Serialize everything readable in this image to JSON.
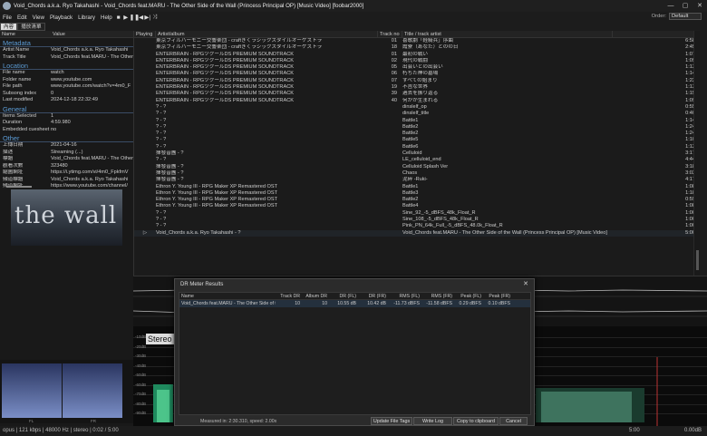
{
  "window": {
    "title": "Void_Chords a.k.a. Ryo Takahashi - Void_Chords feat.MARU - The Other Side of the Wall (Princess Principal OP) [Music Video]  [foobar2000]",
    "controls": [
      "—",
      "▢",
      "✕"
    ]
  },
  "menu": [
    "File",
    "Edit",
    "View",
    "Playback",
    "Library",
    "Help"
  ],
  "toolbar": [
    "■",
    "▶",
    "❚❚",
    "|◀",
    "▶|",
    "⤨"
  ],
  "order": {
    "label": "Order:",
    "value": "Default"
  },
  "tabs": [
    "內容",
    "播放清單"
  ],
  "properties": {
    "headers": [
      "Name",
      "Value"
    ],
    "sections": [
      {
        "title": "Metadata",
        "rows": [
          [
            "Artist Name",
            "Void_Chords a.k.a. Ryo Takahashi"
          ],
          [
            "Track Title",
            "Void_Chords feat.MARU - The Other"
          ]
        ]
      },
      {
        "title": "Location",
        "rows": [
          [
            "File name",
            "watch"
          ],
          [
            "Folder name",
            "www.youtube.com"
          ],
          [
            "File path",
            "www.youtube.com/watch?v=4m0_F"
          ],
          [
            "Subsong index",
            "0"
          ],
          [
            "Last modified",
            "2024-12-18 22:32:49"
          ]
        ]
      },
      {
        "title": "General",
        "rows": [
          [
            "Items Selected",
            "1"
          ],
          [
            "Duration",
            "4:59.980"
          ],
          [
            "Embedded cuesheet",
            "no"
          ]
        ]
      },
      {
        "title": "Other",
        "rows": [
          [
            "上傳日期",
            "2021-04-16"
          ],
          [
            "描述",
            "Streaming (...)"
          ],
          [
            "標題",
            "Void_Chords feat.MARU - The Other"
          ],
          [
            "觀看次數",
            "323480"
          ],
          [
            "縮圖網址",
            "https://i.ytimg.com/vi/4m0_FpkfmV"
          ],
          [
            "頻道標題",
            "Void_Chords a.k.a. Ryo Takahashi"
          ],
          [
            "頻道網址",
            "https://www.youtube.com/channel/"
          ]
        ]
      }
    ]
  },
  "album_art_text": "the wall",
  "vu": {
    "left_label": "FL",
    "right_label": "FR"
  },
  "playlist": {
    "headers": [
      "Playing",
      "Artist/album",
      "Track no",
      "Title / track artist",
      ""
    ],
    "rows": [
      [
        "",
        "東京フィルハーモニー交響楽団 - craftきくラシックスタイルオーケストラ",
        "01",
        "喜歌劇「軽騎兵」序曲",
        "6:58"
      ],
      [
        "",
        "東京フィルハーモニー交響楽団 - craftきくラシックスタイルオーケストラ",
        "18",
        "霞寮（あなた）とのの日",
        "2:45"
      ],
      [
        "",
        "ENTERBRAIN - RPGツクールDS PREMIUM SOUNDTRACK",
        "01",
        "最初の戦い",
        "1:07"
      ],
      [
        "",
        "ENTERBRAIN - RPGツクールDS PREMIUM SOUNDTRACK",
        "02",
        "現代の戦闘",
        "1:09"
      ],
      [
        "",
        "ENTERBRAIN - RPGツクールDS PREMIUM SOUNDTRACK",
        "05",
        "出会いとの出会い",
        "1:13"
      ],
      [
        "",
        "ENTERBRAIN - RPGツクールDS PREMIUM SOUNDTRACK",
        "06",
        "朽ちた神の墓場",
        "1:14"
      ],
      [
        "",
        "ENTERBRAIN - RPGツクールDS PREMIUM SOUNDTRACK",
        "07",
        "すべての始まり",
        "1:22"
      ],
      [
        "",
        "ENTERBRAIN - RPGツクールDS PREMIUM SOUNDTRACK",
        "19",
        "不吉な世界",
        "1:13"
      ],
      [
        "",
        "ENTERBRAIN - RPGツクールDS PREMIUM SOUNDTRACK",
        "39",
        "過去を振り返る",
        "1:15"
      ],
      [
        "",
        "ENTERBRAIN - RPGツクールDS PREMIUM SOUNDTRACK",
        "40",
        "何かが生まれる",
        "1:09"
      ],
      [
        "",
        "? - ?",
        "",
        "dinslelf_op",
        "0:55"
      ],
      [
        "",
        "? - ?",
        "",
        "dinslelf_title",
        "0:40"
      ],
      [
        "",
        "? - ?",
        "",
        "Battle1",
        "1:14"
      ],
      [
        "",
        "? - ?",
        "",
        "Battle2",
        "1:24"
      ],
      [
        "",
        "? - ?",
        "",
        "Battle2",
        "1:24"
      ],
      [
        "",
        "? - ?",
        "",
        "Battle5",
        "1:10"
      ],
      [
        "",
        "? - ?",
        "",
        "Battle6",
        "1:12"
      ],
      [
        "",
        "揮發音團 - ?",
        "",
        "Celluloid",
        "3:17"
      ],
      [
        "",
        "? - ?",
        "",
        "LE_celluloid_end",
        "4:44"
      ],
      [
        "",
        "揮發音團 - ?",
        "",
        "Celluloid Splash Ver",
        "3:18"
      ],
      [
        "",
        "揮發音團 - ?",
        "",
        "Chaos",
        "3:02"
      ],
      [
        "",
        "揮發音團 - ?",
        "",
        "泥碎 -Ruki-",
        "4:17"
      ],
      [
        "",
        "Ethron Y. Young III - RPG Maker XP Remastered OST",
        "",
        "Battle1",
        "1:08"
      ],
      [
        "",
        "Ethron Y. Young III - RPG Maker XP Remastered OST",
        "",
        "Battle3",
        "1:18"
      ],
      [
        "",
        "Ethron Y. Young III - RPG Maker XP Remastered OST",
        "",
        "Battle2",
        "0:59"
      ],
      [
        "",
        "Ethron Y. Young III - RPG Maker XP Remastered OST",
        "",
        "Battle4",
        "1:08"
      ],
      [
        "",
        "? - ?",
        "",
        "Sine_92_-5_dBFS_48k_Float_R",
        "1:00"
      ],
      [
        "",
        "? - ?",
        "",
        "Sine_108_-5_dBFS_48k_Float_R",
        "1:00"
      ],
      [
        "",
        "? - ?",
        "",
        "Pink_PN_64k_Full_-5_dBFS_48.0k_Float_R",
        "1:00"
      ],
      [
        "▷",
        "Void_Chords a.k.a. Ryo Takahashi - ?",
        "",
        "Void_Chords feat.MARU - The Other Side of the Wall (Princess Principal OP) [Music Video]",
        "5:00"
      ]
    ]
  },
  "spectrum": {
    "stereo_label": "Stereo",
    "db_labels": [
      "-10dB",
      "-20dB",
      "-30dB",
      "-40dB",
      "-50dB",
      "-60dB",
      "-70dB",
      "-80dB",
      "-90dB"
    ]
  },
  "dialog": {
    "title": "DR Meter Results",
    "headers": [
      "Name",
      "Track DR",
      "Album DR",
      "DR (FL)",
      "DR (FR)",
      "RMS (FL)",
      "RMS (FR)",
      "Peak (FL)",
      "Peak (FR)"
    ],
    "row": [
      "Void_Chords feat.MARU - The Other Side of th...",
      "10",
      "10",
      "10.55 dB",
      "10.42 dB",
      "-11.73 dBFS",
      "-11.58 dBFS",
      "0.29 dBFS",
      "0.10 dBFS"
    ],
    "footer": "Measured in: 2:30.310, speed: 2.00x",
    "buttons": [
      "Update File Tags",
      "Write Log",
      "Copy to clipboard",
      "Cancel"
    ]
  },
  "status": {
    "left": "opus | 121 kbps | 48000 Hz | stereo | 0:02 / 5:00",
    "middle": "5:00",
    "right": "0.00dB"
  }
}
